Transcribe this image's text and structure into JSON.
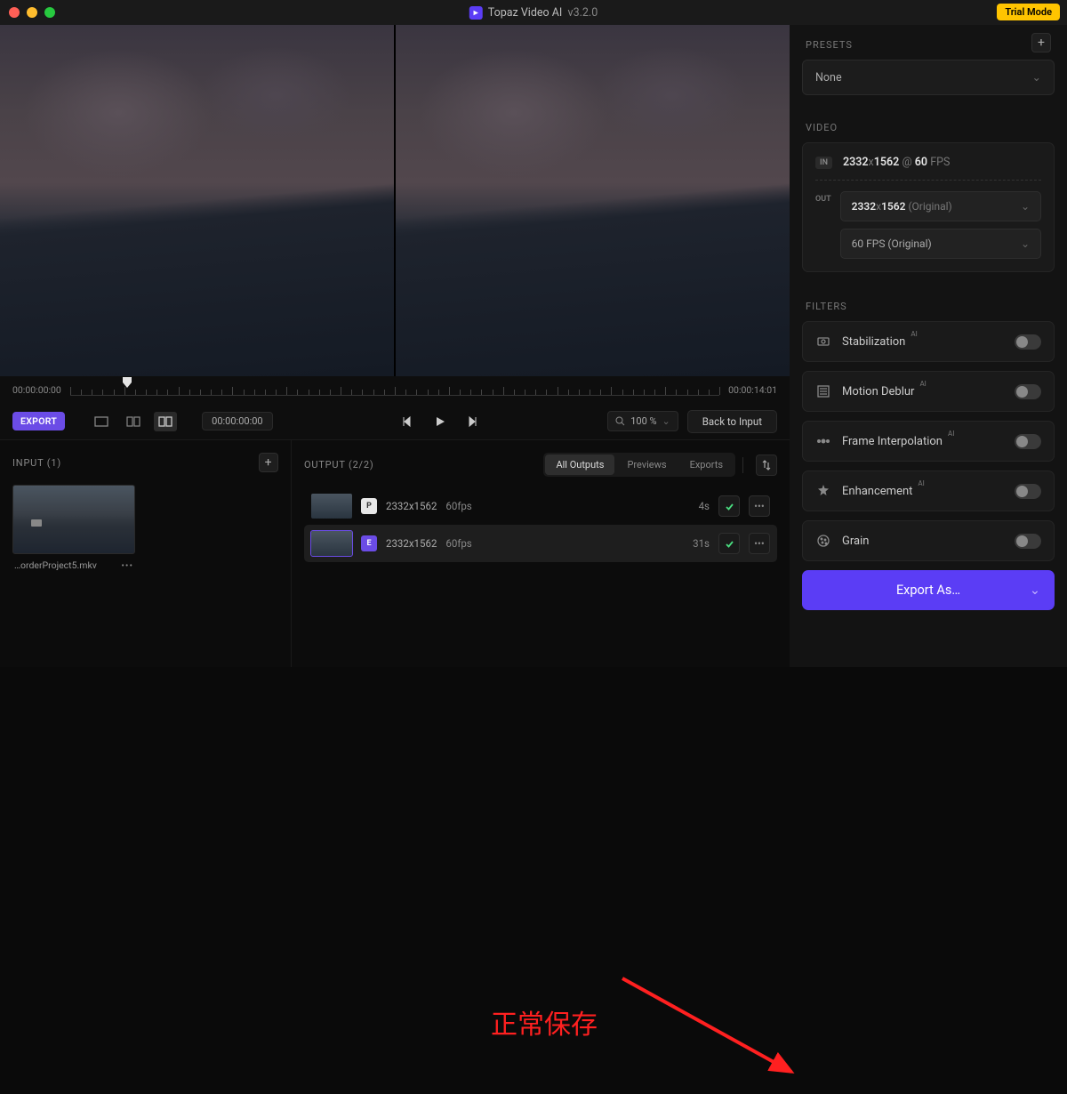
{
  "titlebar": {
    "app_name": "Topaz Video AI",
    "version": "v3.2.0",
    "trial_badge": "Trial Mode"
  },
  "timeline": {
    "start": "00:00:00:00",
    "end": "00:00:14:01"
  },
  "controls": {
    "export_label": "EXPORT",
    "timecode": "00:00:00:00",
    "zoom": "100 %",
    "back_button": "Back to Input"
  },
  "input_panel": {
    "title": "INPUT (1)",
    "filename": "…orderProject5.mkv"
  },
  "output_panel": {
    "title": "OUTPUT (2/2)",
    "tabs": {
      "all": "All Outputs",
      "previews": "Previews",
      "exports": "Exports"
    },
    "rows": [
      {
        "badge": "P",
        "res": "2332x1562",
        "fps": "60fps",
        "dur": "4s"
      },
      {
        "badge": "E",
        "res": "2332x1562",
        "fps": "60fps",
        "dur": "31s"
      }
    ]
  },
  "annotation": "正常保存",
  "sidebar": {
    "presets_label": "PRESETS",
    "preset_value": "None",
    "video_label": "VIDEO",
    "in_badge": "IN",
    "in_res_w": "2332",
    "in_res_x": "x",
    "in_res_h": "1562",
    "in_at": "@",
    "in_fps": "60",
    "in_fps_label": "FPS",
    "out_badge": "OUT",
    "out_res": "2332x1562 (Original)",
    "out_res_w": "2332",
    "out_res_x": "x",
    "out_res_h": "1562",
    "out_res_suffix": "(Original)",
    "out_fps": "60 FPS (Original)",
    "filters_label": "FILTERS",
    "filters": {
      "stabilization": "Stabilization",
      "motion_deblur": "Motion Deblur",
      "frame_interp": "Frame Interpolation",
      "enhancement": "Enhancement",
      "grain": "Grain"
    },
    "ai_badge": "AI",
    "export_as": "Export As…"
  }
}
